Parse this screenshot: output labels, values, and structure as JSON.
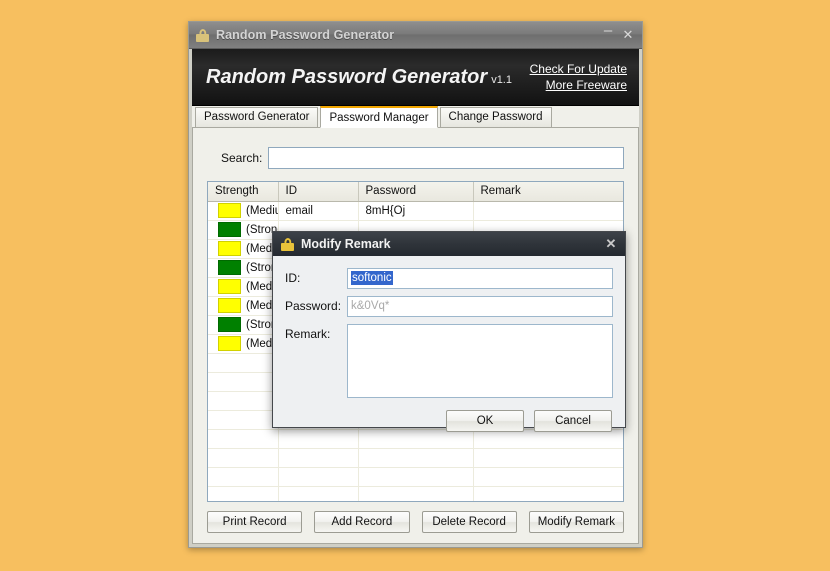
{
  "window": {
    "title": "Random Password Generator",
    "icon": "lock-icon",
    "minimize_label": "–",
    "close_label": "✕"
  },
  "banner": {
    "product": "Random Password Generator",
    "version": "v1.1",
    "links": [
      {
        "label": "Check For Update"
      },
      {
        "label": "More Freeware"
      }
    ]
  },
  "tabs": [
    {
      "label": "Password Generator",
      "active": false
    },
    {
      "label": "Password Manager",
      "active": true
    },
    {
      "label": "Change Password",
      "active": false
    }
  ],
  "search": {
    "label": "Search:",
    "value": "",
    "placeholder": ""
  },
  "table": {
    "columns": [
      "Strength",
      "ID",
      "Password",
      "Remark"
    ],
    "rows": [
      {
        "strength": "(Medium)",
        "color": "#ffff00",
        "id": "email",
        "password": "8mH{Oj",
        "remark": ""
      },
      {
        "strength": "(Strong)",
        "color": "#008000",
        "id": "",
        "password": "",
        "remark": ""
      },
      {
        "strength": "(Medium)",
        "color": "#ffff00",
        "id": "",
        "password": "",
        "remark": ""
      },
      {
        "strength": "(Strong)",
        "color": "#008000",
        "id": "",
        "password": "",
        "remark": ""
      },
      {
        "strength": "(Medium)",
        "color": "#ffff00",
        "id": "",
        "password": "",
        "remark": ""
      },
      {
        "strength": "(Medium)",
        "color": "#ffff00",
        "id": "",
        "password": "",
        "remark": ""
      },
      {
        "strength": "(Strong)",
        "color": "#008000",
        "id": "",
        "password": "",
        "remark": ""
      },
      {
        "strength": "(Medium)",
        "color": "#ffff00",
        "id": "",
        "password": "",
        "remark": ""
      },
      {
        "strength": "",
        "color": "",
        "id": "",
        "password": "",
        "remark": ""
      },
      {
        "strength": "",
        "color": "",
        "id": "",
        "password": "",
        "remark": ""
      },
      {
        "strength": "",
        "color": "",
        "id": "",
        "password": "",
        "remark": ""
      },
      {
        "strength": "",
        "color": "",
        "id": "",
        "password": "",
        "remark": ""
      },
      {
        "strength": "",
        "color": "",
        "id": "",
        "password": "",
        "remark": ""
      },
      {
        "strength": "",
        "color": "",
        "id": "",
        "password": "",
        "remark": ""
      },
      {
        "strength": "",
        "color": "",
        "id": "",
        "password": "",
        "remark": ""
      },
      {
        "strength": "",
        "color": "",
        "id": "",
        "password": "",
        "remark": ""
      }
    ]
  },
  "buttons": {
    "print_record": "Print Record",
    "add_record": "Add Record",
    "delete_record": "Delete Record",
    "modify_remark": "Modify Remark"
  },
  "dialog": {
    "title": "Modify Remark",
    "icon": "lock-icon",
    "close_label": "✕",
    "id_label": "ID:",
    "id_value": "softonic",
    "password_label": "Password:",
    "password_value": "k&0Vq*",
    "remark_label": "Remark:",
    "remark_value": "",
    "ok_label": "OK",
    "cancel_label": "Cancel"
  },
  "colors": {
    "desktop": "#f7bf5f",
    "accent_tab": "#f0a500",
    "strength_medium": "#ffff00",
    "strength_strong": "#008000",
    "selection": "#3366cc"
  }
}
